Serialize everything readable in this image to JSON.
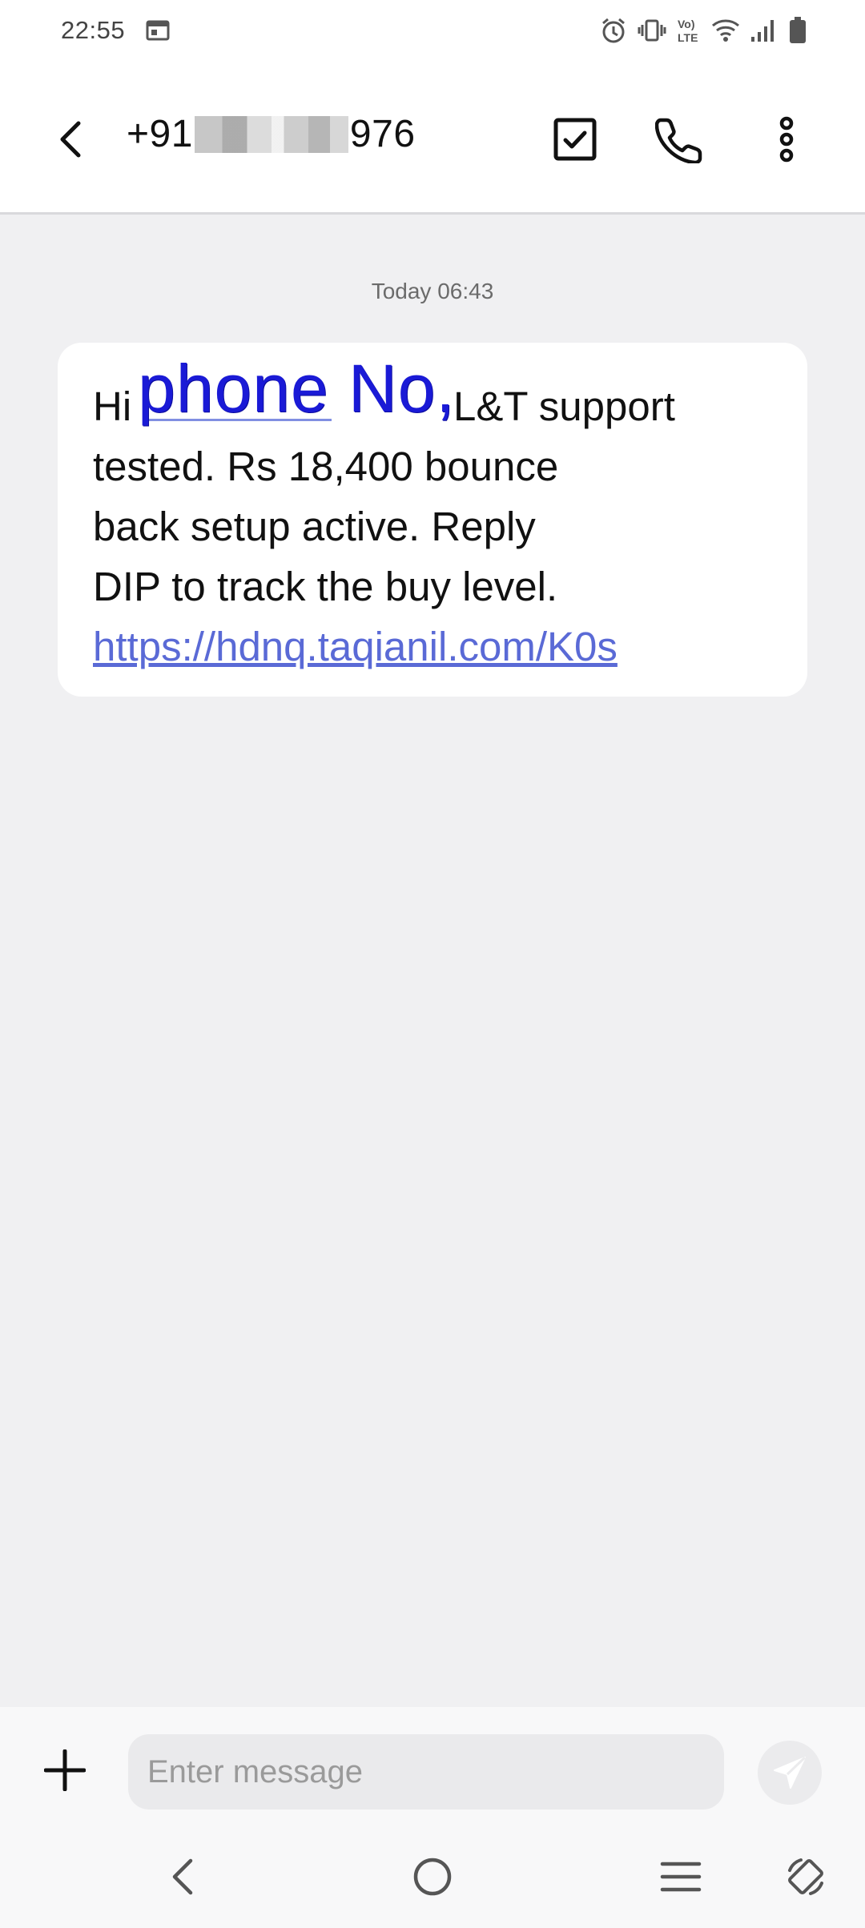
{
  "status_bar": {
    "time": "22:55",
    "icons": [
      "calendar-icon",
      "alarm-icon",
      "vibrate-icon",
      "volte-icon",
      "wifi-icon",
      "signal-icon",
      "battery-icon"
    ],
    "volte_label": "Vo)) LTE"
  },
  "app_bar": {
    "title_prefix": "+91",
    "title_suffix": "976",
    "actions": [
      "select-check-icon",
      "call-icon",
      "more-options-icon"
    ]
  },
  "conversation": {
    "date_stamp": "Today 06:43",
    "message": {
      "greeting": "Hi",
      "overlay_annotation": "phone No,",
      "line1_tail": "L&T support",
      "line2": "tested. Rs 18,400 bounce",
      "line3": "back setup active. Reply",
      "line4": "DIP to track the buy level.",
      "link": "https://hdnq.taqianil.com/K0s"
    }
  },
  "composer": {
    "placeholder": "Enter message",
    "attach_icon": "plus-icon",
    "send_icon": "send-icon"
  },
  "nav_bar": {
    "buttons": [
      "back-nav-icon",
      "home-nav-icon",
      "recents-nav-icon",
      "rotate-icon"
    ]
  },
  "colors": {
    "link": "#5a6ad6",
    "annotation": "#1a1ad6",
    "background": "#f0f0f2",
    "bubble": "#ffffff"
  }
}
